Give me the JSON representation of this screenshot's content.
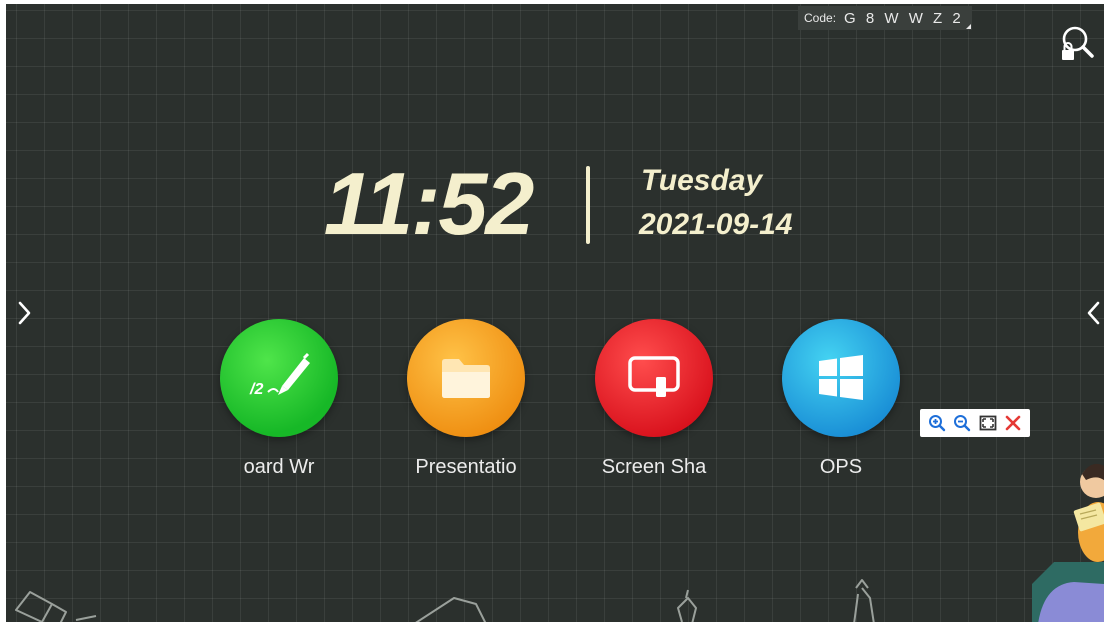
{
  "code": {
    "label": "Code:",
    "value": "G 8 W W Z 2"
  },
  "clock": {
    "time": "11:52",
    "day": "Tuesday",
    "date": "2021-09-14"
  },
  "apps": [
    {
      "label": "oard     Wr",
      "icon": "whiteboard-pen-icon",
      "color": "#22c32e"
    },
    {
      "label": "Presentatio",
      "icon": "folder-icon",
      "color": "#f4a223"
    },
    {
      "label": "Screen Sha",
      "icon": "screen-share-icon",
      "color": "#e8212a"
    },
    {
      "label": "OPS",
      "icon": "windows-icon",
      "color": "#1da7e2"
    }
  ],
  "icons": {
    "search": "search-lock-icon",
    "left_arrow": "chevron-right-icon",
    "right_arrow": "chevron-left-icon",
    "zoom_in": "zoom-in-icon",
    "zoom_out": "zoom-out-icon",
    "fit": "fit-screen-icon",
    "close": "close-icon"
  },
  "colors": {
    "background": "#2b302d",
    "clock_text": "#f4efcd",
    "close": "#e53935",
    "zoom": "#1e6fd9"
  }
}
